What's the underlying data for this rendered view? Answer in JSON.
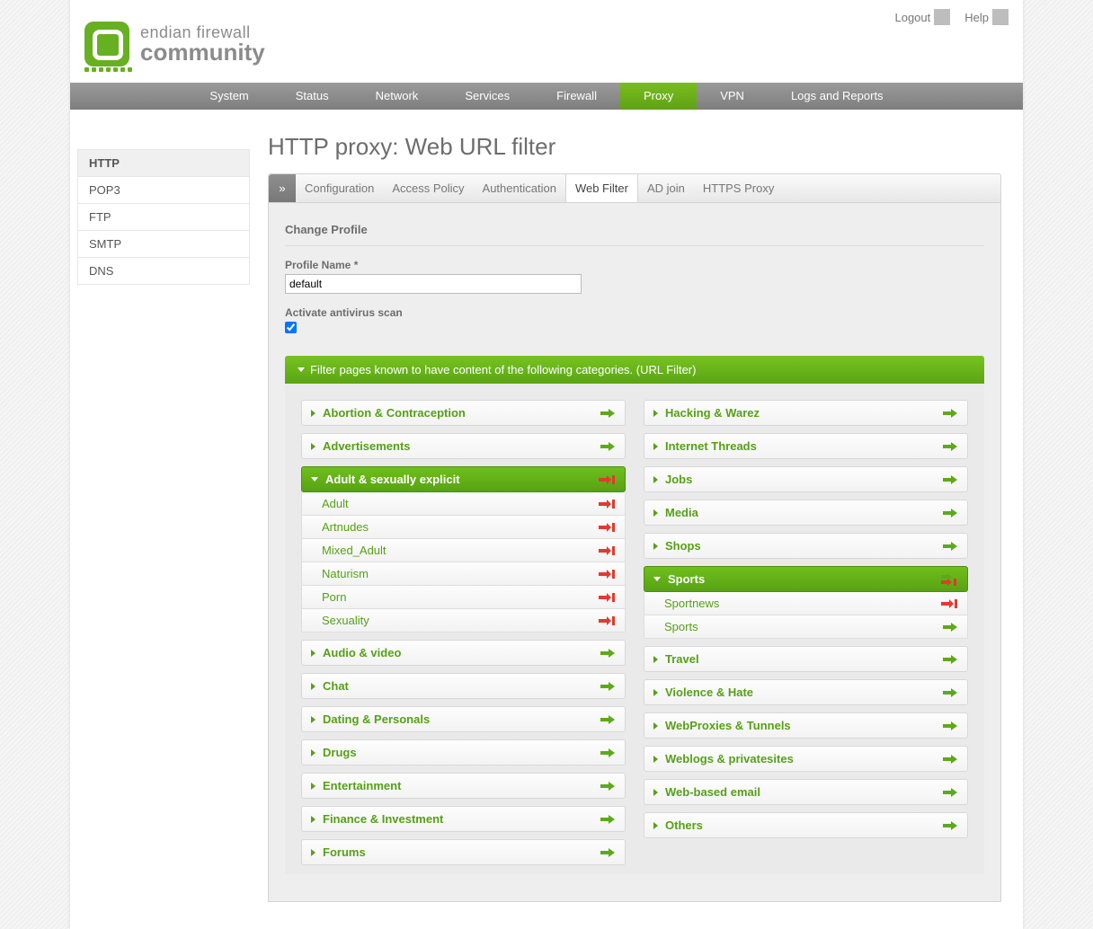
{
  "top": {
    "logout": "Logout",
    "help": "Help"
  },
  "logo": {
    "line1": "endian firewall",
    "line2": "community"
  },
  "mainnav": {
    "items": [
      "System",
      "Status",
      "Network",
      "Services",
      "Firewall",
      "Proxy",
      "VPN",
      "Logs and Reports"
    ],
    "active": 5
  },
  "sidebar": {
    "items": [
      "HTTP",
      "POP3",
      "FTP",
      "SMTP",
      "DNS"
    ],
    "active": 0
  },
  "page_title": "HTTP proxy: Web URL filter",
  "subtabs": {
    "items": [
      "Configuration",
      "Access Policy",
      "Authentication",
      "Web Filter",
      "AD join",
      "HTTPS Proxy"
    ],
    "active": 3
  },
  "panel": {
    "section_title": "Change Profile",
    "profile_label": "Profile Name *",
    "profile_value": "default",
    "av_label": "Activate antivirus scan",
    "av_checked": true,
    "filter_header": "Filter pages known to have content of the following categories. (URL Filter)"
  },
  "left_cats": [
    {
      "name": "Abortion & Contraception",
      "status": "pass",
      "expanded": false
    },
    {
      "name": "Advertisements",
      "status": "pass",
      "expanded": false
    },
    {
      "name": "Adult & sexually explicit",
      "status": "block",
      "expanded": true,
      "sub": [
        {
          "name": "Adult",
          "status": "block"
        },
        {
          "name": "Artnudes",
          "status": "block"
        },
        {
          "name": "Mixed_Adult",
          "status": "block"
        },
        {
          "name": "Naturism",
          "status": "block"
        },
        {
          "name": "Porn",
          "status": "block"
        },
        {
          "name": "Sexuality",
          "status": "block"
        }
      ]
    },
    {
      "name": "Audio & video",
      "status": "pass",
      "expanded": false
    },
    {
      "name": "Chat",
      "status": "pass",
      "expanded": false
    },
    {
      "name": "Dating & Personals",
      "status": "pass",
      "expanded": false
    },
    {
      "name": "Drugs",
      "status": "pass",
      "expanded": false
    },
    {
      "name": "Entertainment",
      "status": "pass",
      "expanded": false
    },
    {
      "name": "Finance & Investment",
      "status": "pass",
      "expanded": false
    },
    {
      "name": "Forums",
      "status": "pass",
      "expanded": false
    }
  ],
  "right_cats": [
    {
      "name": "Hacking & Warez",
      "status": "pass",
      "expanded": false
    },
    {
      "name": "Internet Threads",
      "status": "pass",
      "expanded": false
    },
    {
      "name": "Jobs",
      "status": "pass",
      "expanded": false
    },
    {
      "name": "Media",
      "status": "pass",
      "expanded": false
    },
    {
      "name": "Shops",
      "status": "pass",
      "expanded": false
    },
    {
      "name": "Sports",
      "status": "mixed",
      "expanded": true,
      "sub": [
        {
          "name": "Sportnews",
          "status": "block"
        },
        {
          "name": "Sports",
          "status": "pass"
        }
      ]
    },
    {
      "name": "Travel",
      "status": "pass",
      "expanded": false
    },
    {
      "name": "Violence & Hate",
      "status": "pass",
      "expanded": false
    },
    {
      "name": "WebProxies & Tunnels",
      "status": "pass",
      "expanded": false
    },
    {
      "name": "Weblogs & privatesites",
      "status": "pass",
      "expanded": false
    },
    {
      "name": "Web-based email",
      "status": "pass",
      "expanded": false
    },
    {
      "name": "Others",
      "status": "pass",
      "expanded": false
    }
  ]
}
